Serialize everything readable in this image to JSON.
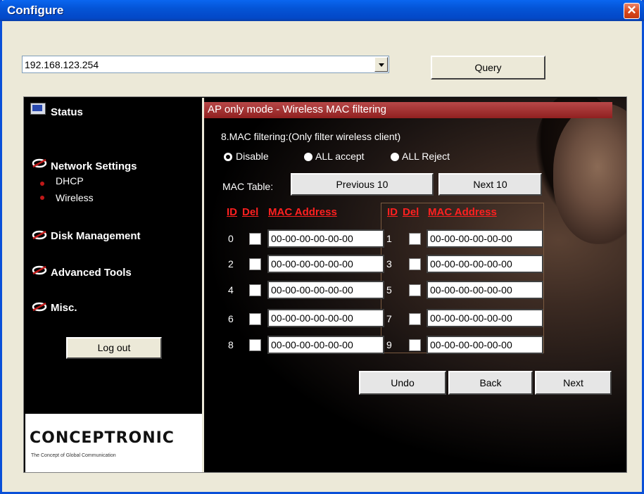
{
  "window": {
    "title": "Configure"
  },
  "top": {
    "address_value": "192.168.123.254",
    "query_label": "Query"
  },
  "sidebar": {
    "status": "Status",
    "network_settings": "Network Settings",
    "dhcp": "DHCP",
    "wireless": "Wireless",
    "disk_management": "Disk Management",
    "advanced_tools": "Advanced Tools",
    "misc": "Misc.",
    "logout": "Log out",
    "logo_name": "CONCEPTRONIC",
    "logo_tag": "The Concept of Global Communication"
  },
  "content": {
    "mode_title": "AP only mode - Wireless MAC filtering",
    "section_label": "8.MAC filtering:(Only filter wireless client)",
    "radios": [
      {
        "label": "Disable",
        "checked": true
      },
      {
        "label": "ALL accept",
        "checked": false
      },
      {
        "label": "ALL Reject",
        "checked": false
      }
    ],
    "mac_table_label": "MAC Table:",
    "prev_label": "Previous 10",
    "next10_label": "Next 10",
    "headers": {
      "id": "ID",
      "del": "Del",
      "mac": "MAC Address"
    },
    "rows": [
      {
        "left_id": "0",
        "left_mac": "00-00-00-00-00-00",
        "right_id": "1",
        "right_mac": "00-00-00-00-00-00"
      },
      {
        "left_id": "2",
        "left_mac": "00-00-00-00-00-00",
        "right_id": "3",
        "right_mac": "00-00-00-00-00-00"
      },
      {
        "left_id": "4",
        "left_mac": "00-00-00-00-00-00",
        "right_id": "5",
        "right_mac": "00-00-00-00-00-00"
      },
      {
        "left_id": "6",
        "left_mac": "00-00-00-00-00-00",
        "right_id": "7",
        "right_mac": "00-00-00-00-00-00"
      },
      {
        "left_id": "8",
        "left_mac": "00-00-00-00-00-00",
        "right_id": "9",
        "right_mac": "00-00-00-00-00-00"
      }
    ],
    "undo_label": "Undo",
    "back_label": "Back",
    "next_label": "Next"
  },
  "colors": {
    "title_bar": "#0454d6",
    "accent_red": "#ff2020",
    "mode_bar": "#a83232"
  },
  "icons": {
    "status": "monitor-icon",
    "menu": "swirl-icon",
    "close": "close-icon"
  }
}
